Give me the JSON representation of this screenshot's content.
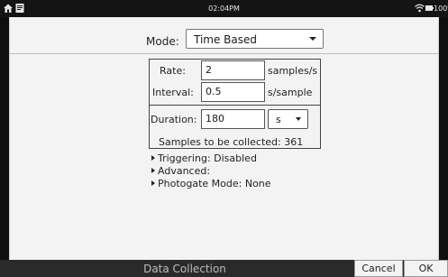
{
  "status_bar": {
    "time": "02:04PM",
    "battery": "100%",
    "icons": [
      "home-icon",
      "document-icon",
      "wifi-icon",
      "battery-icon"
    ]
  },
  "mode": {
    "label": "Mode:",
    "selected": "Time Based"
  },
  "rate": {
    "label": "Rate:",
    "value": "2",
    "unit": "samples/s"
  },
  "interval": {
    "label": "Interval:",
    "value": "0.5",
    "unit": "s/sample"
  },
  "duration": {
    "label": "Duration:",
    "value": "180",
    "unit_selected": "s"
  },
  "samples_text": "Samples to be collected: 361",
  "expanders": [
    {
      "label": "Triggering: Disabled"
    },
    {
      "label": "Advanced:"
    },
    {
      "label": "Photogate Mode: None"
    }
  ],
  "footer": {
    "title": "Data Collection",
    "cancel_label": "Cancel",
    "ok_label": "OK"
  }
}
